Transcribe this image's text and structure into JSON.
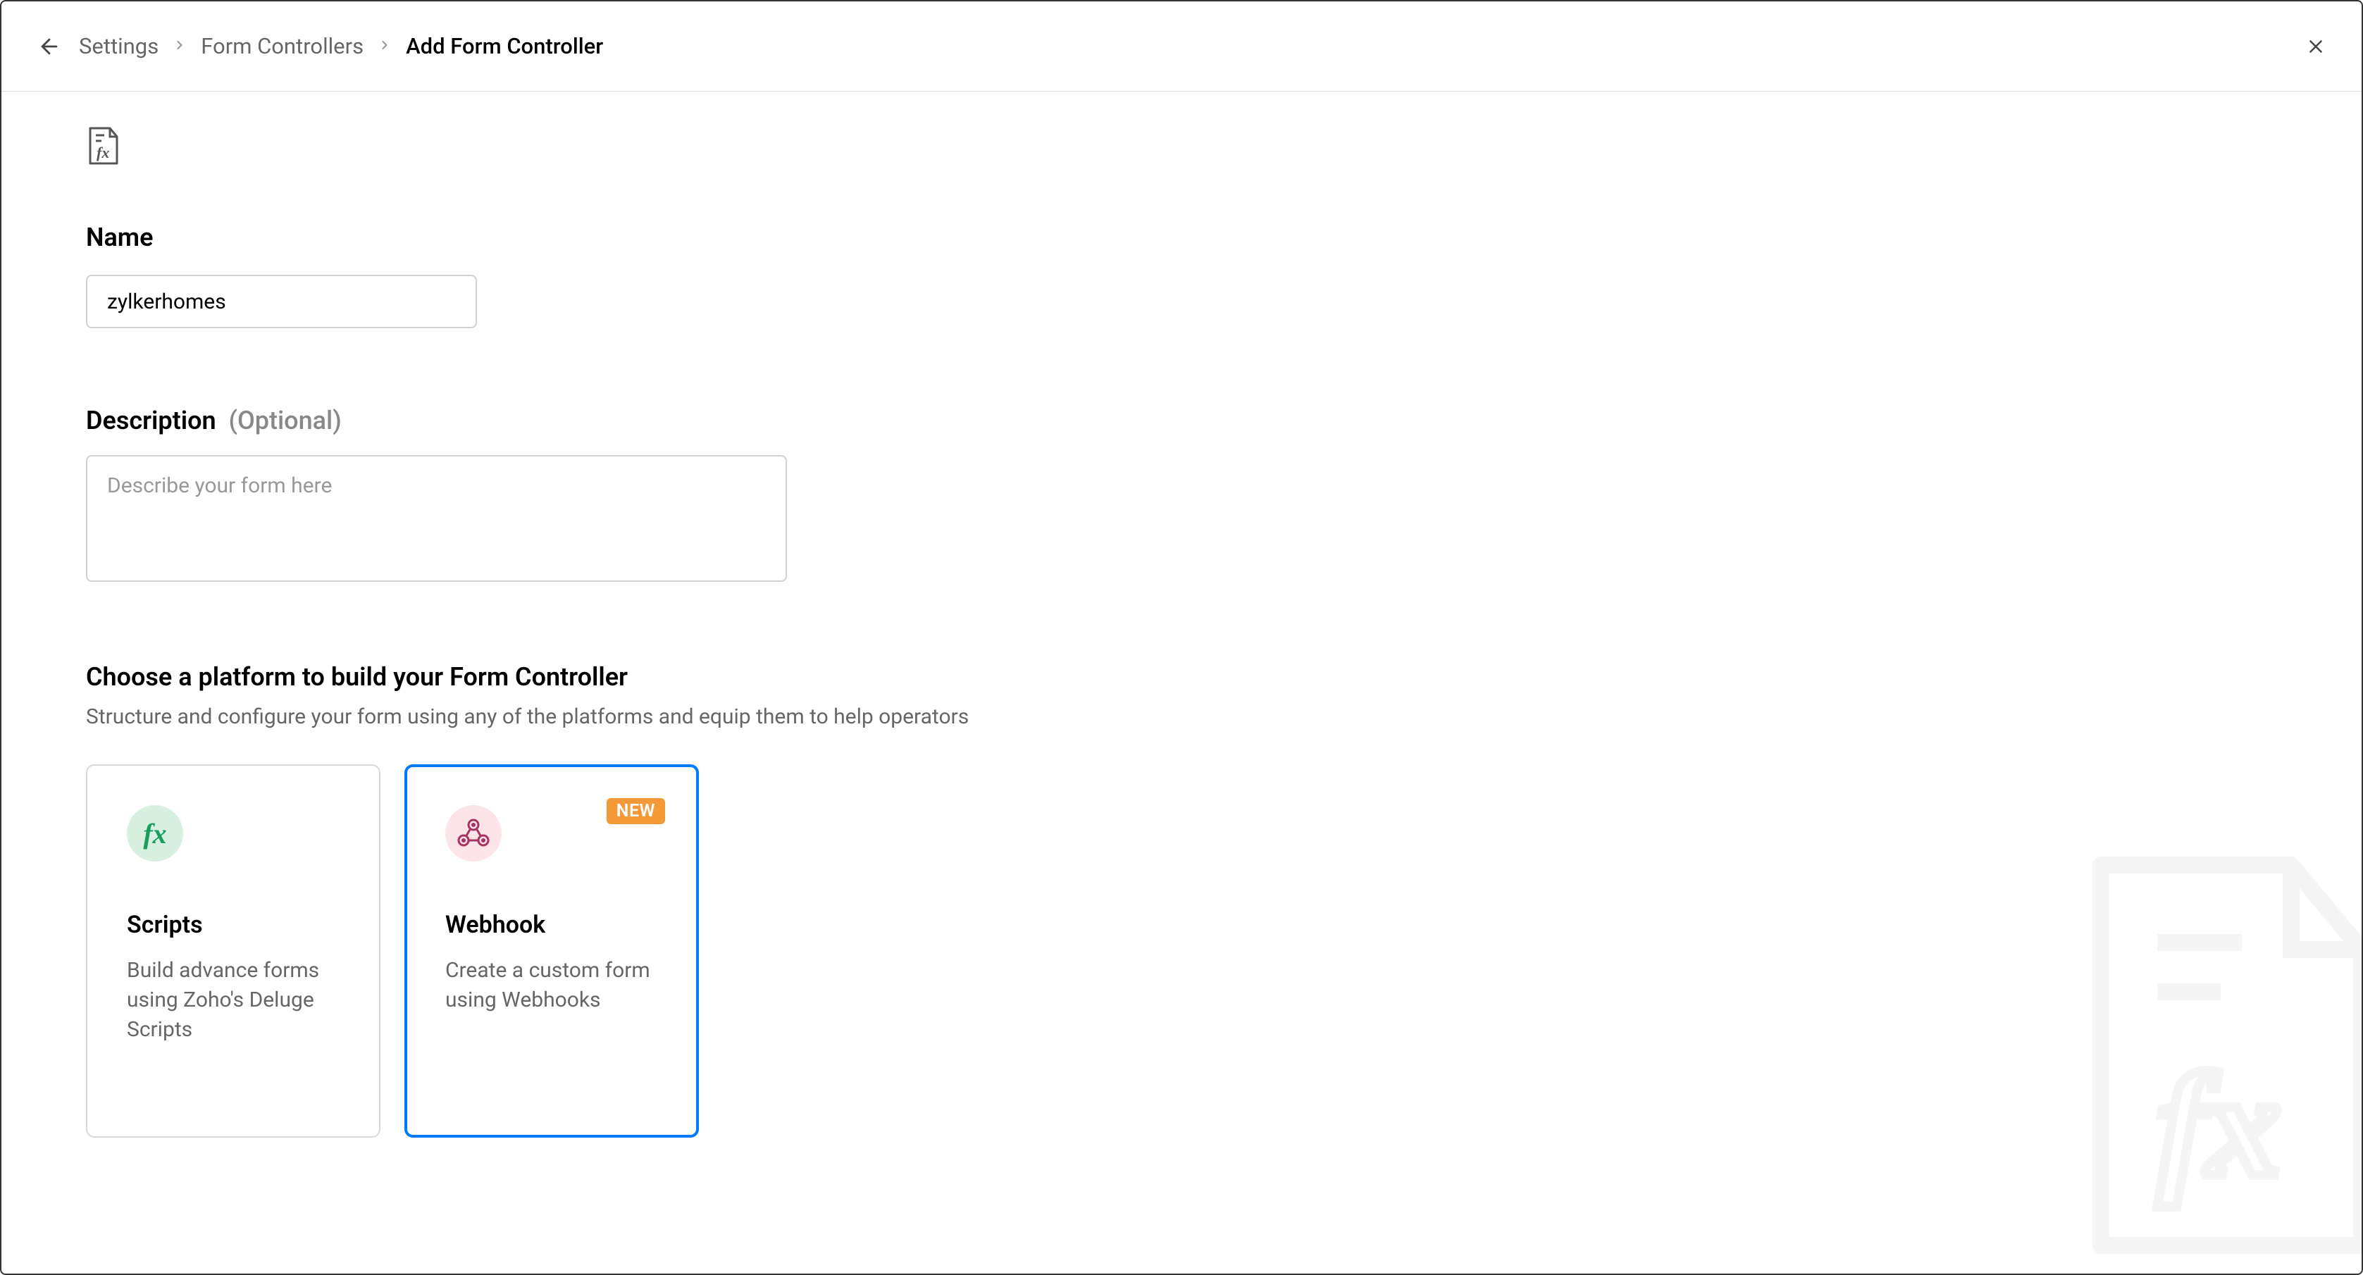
{
  "breadcrumb": {
    "item1": "Settings",
    "item2": "Form Controllers",
    "current": "Add Form Controller"
  },
  "form": {
    "name_label": "Name",
    "name_value": "zylkerhomes",
    "description_label": "Description",
    "description_optional": "(Optional)",
    "description_placeholder": "Describe your form here",
    "description_value": ""
  },
  "platform": {
    "title": "Choose a platform to build your Form Controller",
    "subtitle": "Structure and configure your form using any of the platforms and equip them to help operators",
    "scripts": {
      "title": "Scripts",
      "desc": "Build advance forms using Zoho's Deluge Scripts"
    },
    "webhook": {
      "title": "Webhook",
      "desc": "Create a custom form using Webhooks",
      "badge": "NEW",
      "selected": true
    }
  }
}
